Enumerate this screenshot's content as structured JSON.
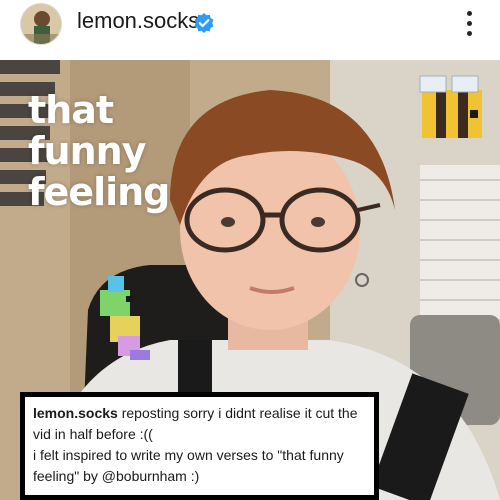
{
  "header": {
    "username": "lemon.socks",
    "verified_icon": "verified-badge-icon",
    "more_icon": "more-vertical-icon",
    "accent": "#2d9cf5"
  },
  "post": {
    "overlay_lines": [
      "that",
      "funny",
      "feeling"
    ],
    "stickers": [
      "bee-sticker",
      "parrot-sticker"
    ]
  },
  "caption": {
    "username": "lemon.socks",
    "line1": "reposting sorry i didnt realise it cut the",
    "line2": "vid in half before :((",
    "line3": "i felt inspired to write my own verses to \"that funny",
    "line4": "feeling\" by",
    "mention": "@boburnham",
    "line4_end": ":)"
  }
}
